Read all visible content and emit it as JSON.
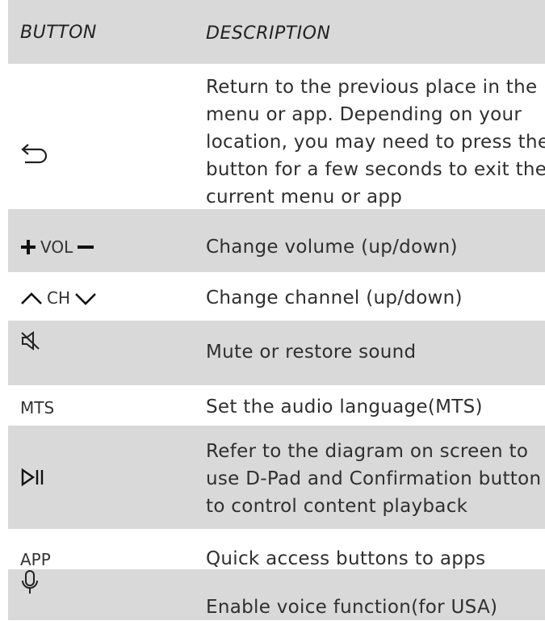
{
  "header": {
    "col_button": "BUTTON",
    "col_description": "DESCRIPTION"
  },
  "rows": [
    {
      "button_icon": "back-arrow-icon",
      "description_lines": [
        "Return to the previous place in the",
        "menu or app. Depending on your",
        "location, you may need to press the",
        "button for a few seconds to exit the",
        "current menu or app"
      ]
    },
    {
      "button_icon": "plus-icon",
      "button_label": "VOL",
      "button_icon2": "minus-icon",
      "description": "Change volume (up/down)"
    },
    {
      "button_icon": "chevron-up-icon",
      "button_label": "CH",
      "button_icon2": "chevron-down-icon",
      "description": "Change channel (up/down)"
    },
    {
      "button_icon": "mute-icon",
      "description": "Mute or restore sound"
    },
    {
      "button_label": "MTS",
      "description": "Set the audio language(MTS)"
    },
    {
      "button_icon": "play-pause-icon",
      "description_lines": [
        "Refer to the diagram on screen to",
        "use D-Pad and Confirmation button",
        "to control content playback"
      ]
    },
    {
      "button_label": "APP",
      "description": "Quick access buttons to apps"
    },
    {
      "button_icon": "microphone-icon",
      "description": "Enable voice function(for USA)"
    }
  ]
}
